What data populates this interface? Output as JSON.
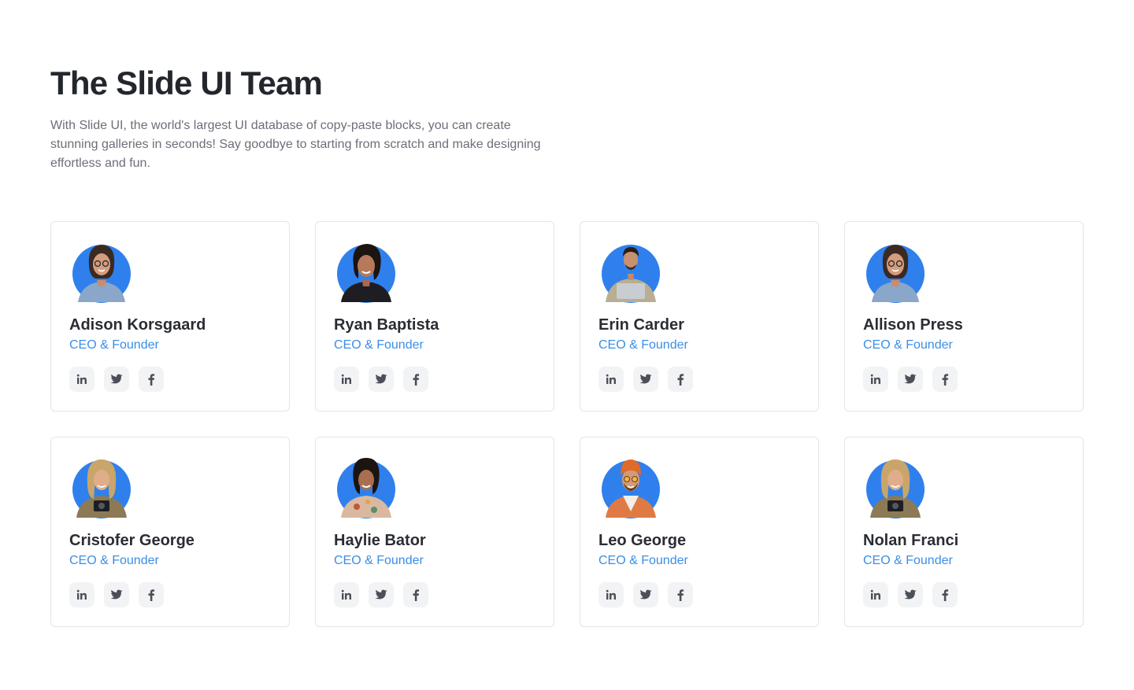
{
  "header": {
    "title": "The Slide UI Team",
    "description": "With Slide UI, the world's largest UI database of copy-paste blocks, you can create stunning galleries in seconds! Say goodbye to starting from scratch and make designing effortless and fun."
  },
  "colors": {
    "avatar_bg": "#2f80ed",
    "role_text": "#3a8ee6",
    "icon": "#4b4f58",
    "icon_bg": "#f2f3f5"
  },
  "social_icons": [
    "linkedin-icon",
    "twitter-icon",
    "facebook-icon"
  ],
  "team": [
    {
      "name": "Adison Korsgaard",
      "role": "CEO & Founder",
      "avatar": "woman-glasses-blue-shirt"
    },
    {
      "name": "Ryan Baptista",
      "role": "CEO & Founder",
      "avatar": "woman-black-shirt"
    },
    {
      "name": "Erin Carder",
      "role": "CEO & Founder",
      "avatar": "man-with-laptop"
    },
    {
      "name": "Allison Press",
      "role": "CEO & Founder",
      "avatar": "woman-glasses-blue-shirt"
    },
    {
      "name": "Cristofer George",
      "role": "CEO & Founder",
      "avatar": "woman-with-camera"
    },
    {
      "name": "Haylie Bator",
      "role": "CEO & Founder",
      "avatar": "woman-floral-shirt"
    },
    {
      "name": "Leo George",
      "role": "CEO & Founder",
      "avatar": "man-orange-beanie"
    },
    {
      "name": "Nolan Franci",
      "role": "CEO & Founder",
      "avatar": "woman-with-camera"
    }
  ]
}
